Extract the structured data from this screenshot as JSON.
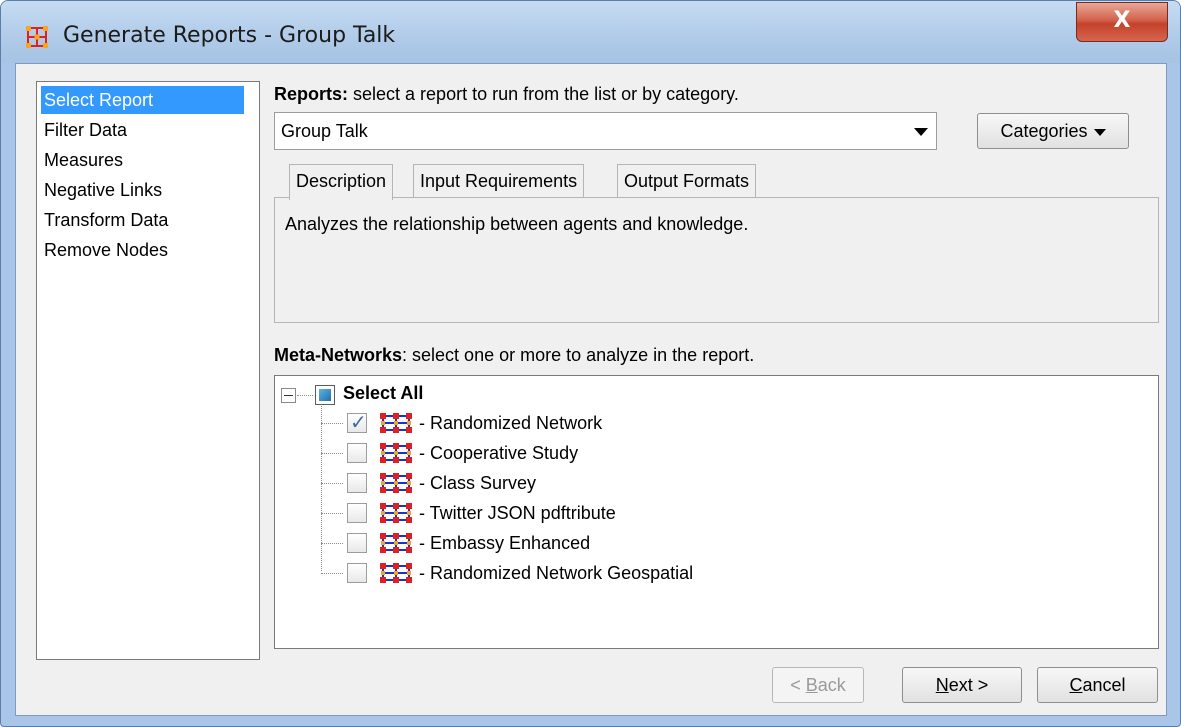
{
  "window": {
    "title": "Generate Reports - Group Talk",
    "close_label": "X"
  },
  "nav": {
    "items": [
      {
        "label": "Select Report",
        "selected": true
      },
      {
        "label": "Filter Data",
        "selected": false
      },
      {
        "label": "Measures",
        "selected": false
      },
      {
        "label": "Negative Links",
        "selected": false
      },
      {
        "label": "Transform Data",
        "selected": false
      },
      {
        "label": "Remove Nodes",
        "selected": false
      }
    ]
  },
  "reports": {
    "heading": "Reports:",
    "instruction": " select a report to run from the list or by category.",
    "selected_report": "Group Talk",
    "categories_label": "Categories"
  },
  "tabs": {
    "items": [
      "Description",
      "Input Requirements",
      "Output Formats"
    ],
    "active": "Description",
    "description_text": "Analyzes the relationship between agents and knowledge."
  },
  "meta_networks": {
    "heading": "Meta-Networks",
    "instruction": ": select one or more to analyze in the report.",
    "select_all_label": "Select All",
    "items": [
      {
        "label": "- Randomized Network",
        "checked": true
      },
      {
        "label": "- Cooperative Study",
        "checked": false
      },
      {
        "label": "- Class Survey",
        "checked": false
      },
      {
        "label": "- Twitter JSON pdftribute",
        "checked": false
      },
      {
        "label": "- Embassy Enhanced",
        "checked": false
      },
      {
        "label": "- Randomized Network Geospatial",
        "checked": false
      }
    ]
  },
  "footer": {
    "back_prefix": "< ",
    "back_mnemonic": "B",
    "back_rest": "ack",
    "next_mnemonic": "N",
    "next_rest": "ext >",
    "cancel_mnemonic": "C",
    "cancel_rest": "ancel"
  },
  "colors": {
    "selection": "#3399ff",
    "window_frame": "#a9c6e8",
    "close_button": "#c4412a"
  },
  "icons": {
    "app": "network-grid-icon",
    "meta_network": "meta-network-icon"
  }
}
